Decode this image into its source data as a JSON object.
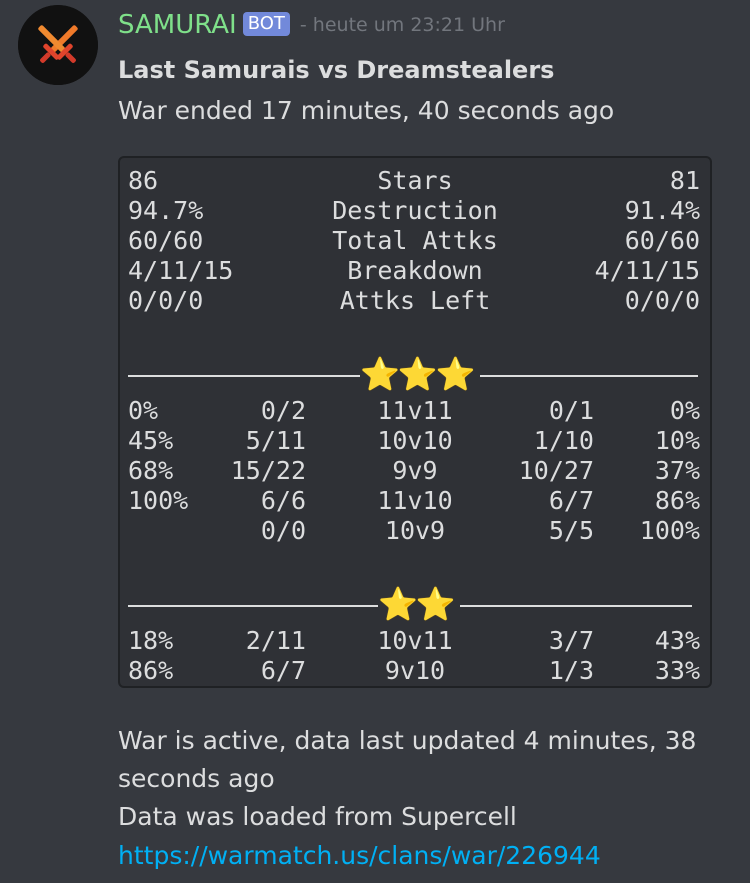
{
  "message": {
    "username": "SAMURAI",
    "bot_badge": "BOT",
    "timestamp": "- heute um 23:21 Uhr",
    "title": "Last Samurais vs Dreamstealers",
    "subtitle": "War ended 17 minutes, 40 seconds ago",
    "footer_line1": "War is active, data last updated 4 minutes, 38",
    "footer_line2": "seconds ago",
    "footer_line3": "Data was loaded from Supercell",
    "link": "https://warmatch.us/clans/war/226944"
  },
  "summary": {
    "rows": [
      {
        "left": "86",
        "label": "Stars",
        "right": "81"
      },
      {
        "left": "94.7%",
        "label": "Destruction",
        "right": "91.4%"
      },
      {
        "left": "60/60",
        "label": "Total Attks",
        "right": "60/60"
      },
      {
        "left": "4/11/15",
        "label": "Breakdown",
        "right": "4/11/15"
      },
      {
        "left": "0/0/0",
        "label": "Attks Left",
        "right": "0/0/0"
      }
    ]
  },
  "three_star": {
    "divider_stars": "⭐⭐⭐",
    "rows": [
      {
        "lpct": "0%",
        "lratio": "0/2",
        "match": "11v11",
        "rratio": "0/1",
        "rpct": "0%"
      },
      {
        "lpct": "45%",
        "lratio": "5/11",
        "match": "10v10",
        "rratio": "1/10",
        "rpct": "10%"
      },
      {
        "lpct": "68%",
        "lratio": "15/22",
        "match": "9v9",
        "rratio": "10/27",
        "rpct": "37%"
      },
      {
        "lpct": "100%",
        "lratio": "6/6",
        "match": "11v10",
        "rratio": "6/7",
        "rpct": "86%"
      },
      {
        "lpct": "",
        "lratio": "0/0",
        "match": "10v9",
        "rratio": "5/5",
        "rpct": "100%"
      }
    ]
  },
  "two_star": {
    "divider_stars": "⭐⭐",
    "rows": [
      {
        "lpct": "18%",
        "lratio": "2/11",
        "match": "10v11",
        "rratio": "3/7",
        "rpct": "43%"
      },
      {
        "lpct": "86%",
        "lratio": "6/7",
        "match": "9v10",
        "rratio": "1/3",
        "rpct": "33%"
      }
    ]
  },
  "colors": {
    "background": "#36393f",
    "codeblock": "#2f3136",
    "username": "#7fe08a",
    "bot_badge": "#7289da",
    "link": "#00b0f4"
  },
  "icons": {
    "avatar": "crossed-swords-icon",
    "star": "star-icon"
  }
}
